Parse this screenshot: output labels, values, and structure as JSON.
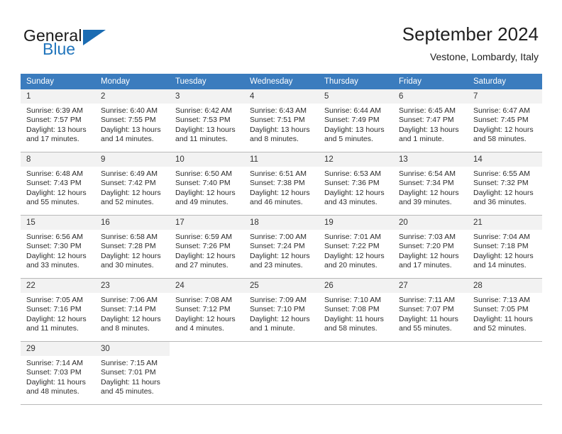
{
  "brand": {
    "name_top": "General",
    "name_bottom": "Blue",
    "triangle_color": "#1b6cb3",
    "blue_color": "#2175bc"
  },
  "header": {
    "title": "September 2024",
    "subtitle": "Vestone, Lombardy, Italy"
  },
  "theme": {
    "header_row_bg": "#3b7cbe",
    "daynum_bg": "#f2f2f2",
    "grid_line": "#b9b9b9"
  },
  "weekday_headers": [
    "Sunday",
    "Monday",
    "Tuesday",
    "Wednesday",
    "Thursday",
    "Friday",
    "Saturday"
  ],
  "weeks": [
    [
      {
        "day": "1",
        "sunrise": "Sunrise: 6:39 AM",
        "sunset": "Sunset: 7:57 PM",
        "daylight": "Daylight: 13 hours and 17 minutes."
      },
      {
        "day": "2",
        "sunrise": "Sunrise: 6:40 AM",
        "sunset": "Sunset: 7:55 PM",
        "daylight": "Daylight: 13 hours and 14 minutes."
      },
      {
        "day": "3",
        "sunrise": "Sunrise: 6:42 AM",
        "sunset": "Sunset: 7:53 PM",
        "daylight": "Daylight: 13 hours and 11 minutes."
      },
      {
        "day": "4",
        "sunrise": "Sunrise: 6:43 AM",
        "sunset": "Sunset: 7:51 PM",
        "daylight": "Daylight: 13 hours and 8 minutes."
      },
      {
        "day": "5",
        "sunrise": "Sunrise: 6:44 AM",
        "sunset": "Sunset: 7:49 PM",
        "daylight": "Daylight: 13 hours and 5 minutes."
      },
      {
        "day": "6",
        "sunrise": "Sunrise: 6:45 AM",
        "sunset": "Sunset: 7:47 PM",
        "daylight": "Daylight: 13 hours and 1 minute."
      },
      {
        "day": "7",
        "sunrise": "Sunrise: 6:47 AM",
        "sunset": "Sunset: 7:45 PM",
        "daylight": "Daylight: 12 hours and 58 minutes."
      }
    ],
    [
      {
        "day": "8",
        "sunrise": "Sunrise: 6:48 AM",
        "sunset": "Sunset: 7:43 PM",
        "daylight": "Daylight: 12 hours and 55 minutes."
      },
      {
        "day": "9",
        "sunrise": "Sunrise: 6:49 AM",
        "sunset": "Sunset: 7:42 PM",
        "daylight": "Daylight: 12 hours and 52 minutes."
      },
      {
        "day": "10",
        "sunrise": "Sunrise: 6:50 AM",
        "sunset": "Sunset: 7:40 PM",
        "daylight": "Daylight: 12 hours and 49 minutes."
      },
      {
        "day": "11",
        "sunrise": "Sunrise: 6:51 AM",
        "sunset": "Sunset: 7:38 PM",
        "daylight": "Daylight: 12 hours and 46 minutes."
      },
      {
        "day": "12",
        "sunrise": "Sunrise: 6:53 AM",
        "sunset": "Sunset: 7:36 PM",
        "daylight": "Daylight: 12 hours and 43 minutes."
      },
      {
        "day": "13",
        "sunrise": "Sunrise: 6:54 AM",
        "sunset": "Sunset: 7:34 PM",
        "daylight": "Daylight: 12 hours and 39 minutes."
      },
      {
        "day": "14",
        "sunrise": "Sunrise: 6:55 AM",
        "sunset": "Sunset: 7:32 PM",
        "daylight": "Daylight: 12 hours and 36 minutes."
      }
    ],
    [
      {
        "day": "15",
        "sunrise": "Sunrise: 6:56 AM",
        "sunset": "Sunset: 7:30 PM",
        "daylight": "Daylight: 12 hours and 33 minutes."
      },
      {
        "day": "16",
        "sunrise": "Sunrise: 6:58 AM",
        "sunset": "Sunset: 7:28 PM",
        "daylight": "Daylight: 12 hours and 30 minutes."
      },
      {
        "day": "17",
        "sunrise": "Sunrise: 6:59 AM",
        "sunset": "Sunset: 7:26 PM",
        "daylight": "Daylight: 12 hours and 27 minutes."
      },
      {
        "day": "18",
        "sunrise": "Sunrise: 7:00 AM",
        "sunset": "Sunset: 7:24 PM",
        "daylight": "Daylight: 12 hours and 23 minutes."
      },
      {
        "day": "19",
        "sunrise": "Sunrise: 7:01 AM",
        "sunset": "Sunset: 7:22 PM",
        "daylight": "Daylight: 12 hours and 20 minutes."
      },
      {
        "day": "20",
        "sunrise": "Sunrise: 7:03 AM",
        "sunset": "Sunset: 7:20 PM",
        "daylight": "Daylight: 12 hours and 17 minutes."
      },
      {
        "day": "21",
        "sunrise": "Sunrise: 7:04 AM",
        "sunset": "Sunset: 7:18 PM",
        "daylight": "Daylight: 12 hours and 14 minutes."
      }
    ],
    [
      {
        "day": "22",
        "sunrise": "Sunrise: 7:05 AM",
        "sunset": "Sunset: 7:16 PM",
        "daylight": "Daylight: 12 hours and 11 minutes."
      },
      {
        "day": "23",
        "sunrise": "Sunrise: 7:06 AM",
        "sunset": "Sunset: 7:14 PM",
        "daylight": "Daylight: 12 hours and 8 minutes."
      },
      {
        "day": "24",
        "sunrise": "Sunrise: 7:08 AM",
        "sunset": "Sunset: 7:12 PM",
        "daylight": "Daylight: 12 hours and 4 minutes."
      },
      {
        "day": "25",
        "sunrise": "Sunrise: 7:09 AM",
        "sunset": "Sunset: 7:10 PM",
        "daylight": "Daylight: 12 hours and 1 minute."
      },
      {
        "day": "26",
        "sunrise": "Sunrise: 7:10 AM",
        "sunset": "Sunset: 7:08 PM",
        "daylight": "Daylight: 11 hours and 58 minutes."
      },
      {
        "day": "27",
        "sunrise": "Sunrise: 7:11 AM",
        "sunset": "Sunset: 7:07 PM",
        "daylight": "Daylight: 11 hours and 55 minutes."
      },
      {
        "day": "28",
        "sunrise": "Sunrise: 7:13 AM",
        "sunset": "Sunset: 7:05 PM",
        "daylight": "Daylight: 11 hours and 52 minutes."
      }
    ],
    [
      {
        "day": "29",
        "sunrise": "Sunrise: 7:14 AM",
        "sunset": "Sunset: 7:03 PM",
        "daylight": "Daylight: 11 hours and 48 minutes."
      },
      {
        "day": "30",
        "sunrise": "Sunrise: 7:15 AM",
        "sunset": "Sunset: 7:01 PM",
        "daylight": "Daylight: 11 hours and 45 minutes."
      },
      {
        "day": "",
        "sunrise": "",
        "sunset": "",
        "daylight": ""
      },
      {
        "day": "",
        "sunrise": "",
        "sunset": "",
        "daylight": ""
      },
      {
        "day": "",
        "sunrise": "",
        "sunset": "",
        "daylight": ""
      },
      {
        "day": "",
        "sunrise": "",
        "sunset": "",
        "daylight": ""
      },
      {
        "day": "",
        "sunrise": "",
        "sunset": "",
        "daylight": ""
      }
    ]
  ]
}
